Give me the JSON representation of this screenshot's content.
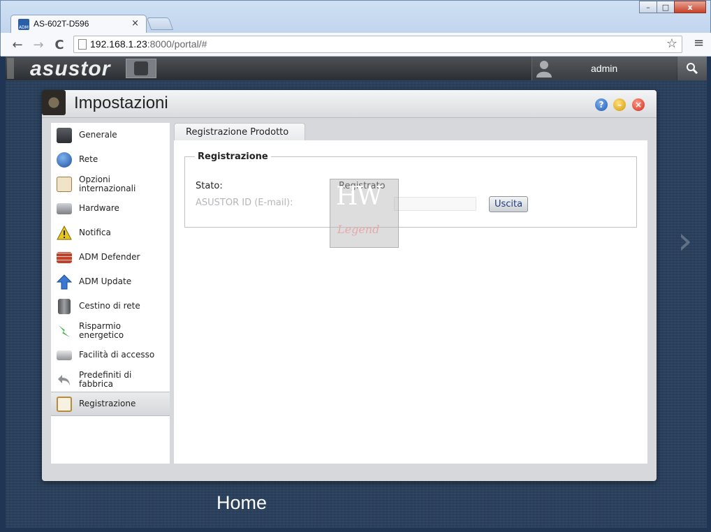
{
  "browser": {
    "tab_title": "AS-602T-D596",
    "tab_close": "×",
    "url_host": "192.168.1.23",
    "url_rest": ":8000/portal/#",
    "back": "←",
    "forward": "→",
    "reload": "C",
    "star": "☆",
    "menu": "≡",
    "win_min": "–",
    "win_max": "□",
    "win_close": "x",
    "favicon_text": "ADM"
  },
  "adm": {
    "logo": "asustor",
    "user": "admin",
    "search_glyph": "🔍"
  },
  "window": {
    "title": "Impostazioni",
    "help": "?",
    "minimize": "–",
    "close": "×"
  },
  "sidebar": {
    "items": [
      {
        "label": "Generale",
        "icon": "server-icon",
        "color": "#3b3f45"
      },
      {
        "label": "Rete",
        "icon": "globe-icon",
        "color": "#2a6cc0"
      },
      {
        "label": "Opzioni internazionali",
        "icon": "calendar-clock-icon",
        "color": "#c9a46b"
      },
      {
        "label": "Hardware",
        "icon": "harddisk-icon",
        "color": "#8a8d91"
      },
      {
        "label": "Notifica",
        "icon": "warning-icon",
        "color": "#e0c21a"
      },
      {
        "label": "ADM Defender",
        "icon": "firewall-icon",
        "color": "#c2412b"
      },
      {
        "label": "ADM Update",
        "icon": "update-arrow-icon",
        "color": "#2e6bc7"
      },
      {
        "label": "Cestino di rete",
        "icon": "trash-icon",
        "color": "#6b6e72"
      },
      {
        "label": "Risparmio energetico",
        "icon": "energy-icon",
        "color": "#3fb04a"
      },
      {
        "label": "Facilità di accesso",
        "icon": "printer-icon",
        "color": "#a3a6aa"
      },
      {
        "label": "Predefiniti di fabbrica",
        "icon": "undo-icon",
        "color": "#9a9da1"
      },
      {
        "label": "Registrazione",
        "icon": "clipboard-icon",
        "color": "#c28c3b"
      }
    ],
    "active_index": 11
  },
  "panel": {
    "tab_label": "Registrazione Prodotto",
    "fieldset_legend": "Registrazione",
    "status_label": "Stato:",
    "status_value": "Registrato",
    "id_label": "ASUSTOR ID (E-mail):",
    "id_value": "",
    "logout_label": "Uscita"
  },
  "watermark": {
    "big": "HW",
    "small": "Legend"
  },
  "desktop": {
    "home_label": "Home",
    "next_glyph": "›"
  }
}
